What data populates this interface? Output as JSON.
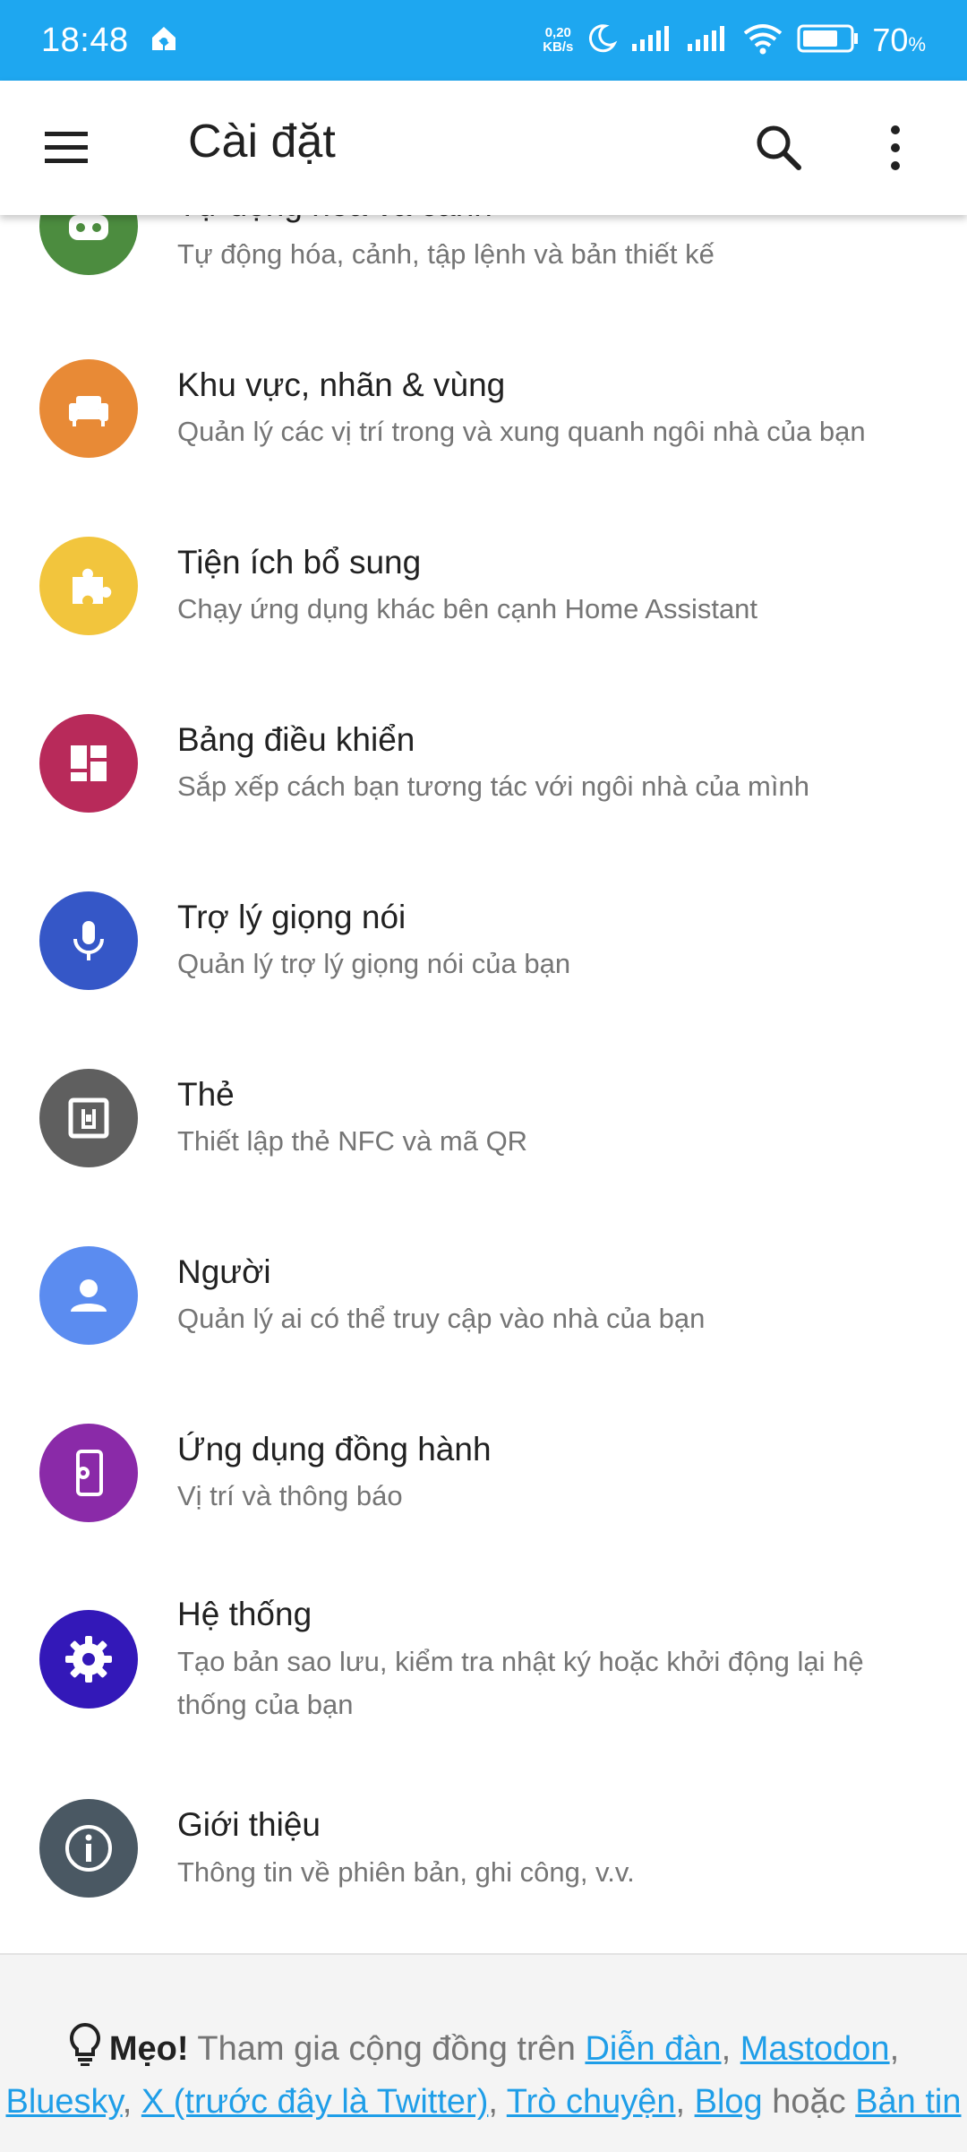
{
  "statusbar": {
    "time": "18:48",
    "net_speed_top": "0,20",
    "net_speed_bottom": "KB/s",
    "battery_percent": "70",
    "battery_unit": "%",
    "color": "#1ea7f0"
  },
  "appbar": {
    "title": "Cài đặt"
  },
  "items": [
    {
      "icon": "robot-icon",
      "color": "#4c8c3f",
      "primary": "Tự động hóa và cảnh",
      "secondary": "Tự động hóa, cảnh, tập lệnh và bản thiết kế"
    },
    {
      "icon": "sofa-icon",
      "color": "#e88a36",
      "primary": "Khu vực, nhãn & vùng",
      "secondary": "Quản lý các vị trí trong và xung quanh ngôi nhà của bạn"
    },
    {
      "icon": "puzzle-icon",
      "color": "#f2c53d",
      "primary": "Tiện ích bổ sung",
      "secondary": "Chạy ứng dụng khác bên cạnh Home Assistant"
    },
    {
      "icon": "dashboard-icon",
      "color": "#b82a5a",
      "primary": "Bảng điều khiển",
      "secondary": "Sắp xếp cách bạn tương tác với ngôi nhà của mình"
    },
    {
      "icon": "microphone-icon",
      "color": "#3557c7",
      "primary": "Trợ lý giọng nói",
      "secondary": "Quản lý trợ lý giọng nói của bạn"
    },
    {
      "icon": "nfc-icon",
      "color": "#5f5f5f",
      "primary": "Thẻ",
      "secondary": "Thiết lập thẻ NFC và mã QR"
    },
    {
      "icon": "person-icon",
      "color": "#5b8cf0",
      "primary": "Người",
      "secondary": "Quản lý ai có thể truy cập vào nhà của bạn"
    },
    {
      "icon": "phone-settings-icon",
      "color": "#8a2aa8",
      "primary": "Ứng dụng đồng hành",
      "secondary": "Vị trí và thông báo"
    },
    {
      "icon": "gear-icon",
      "color": "#3318b8",
      "primary": "Hệ thống",
      "secondary": "Tạo bản sao lưu, kiểm tra nhật ký hoặc khởi động lại hệ thống của bạn"
    },
    {
      "icon": "info-icon",
      "color": "#4a5863",
      "primary": "Giới thiệu",
      "secondary": "Thông tin về phiên bản, ghi công, v.v."
    }
  ],
  "footer": {
    "tip_label": "Mẹo!",
    "tip_text": "Tham gia cộng đồng trên",
    "links": [
      "Diễn đàn",
      "Mastodon",
      "Bluesky",
      "X (trước đây là Twitter)",
      "Trò chuyện",
      "Blog",
      "Bản tin"
    ],
    "sep_comma": ",",
    "sep_or": "hoặc"
  }
}
